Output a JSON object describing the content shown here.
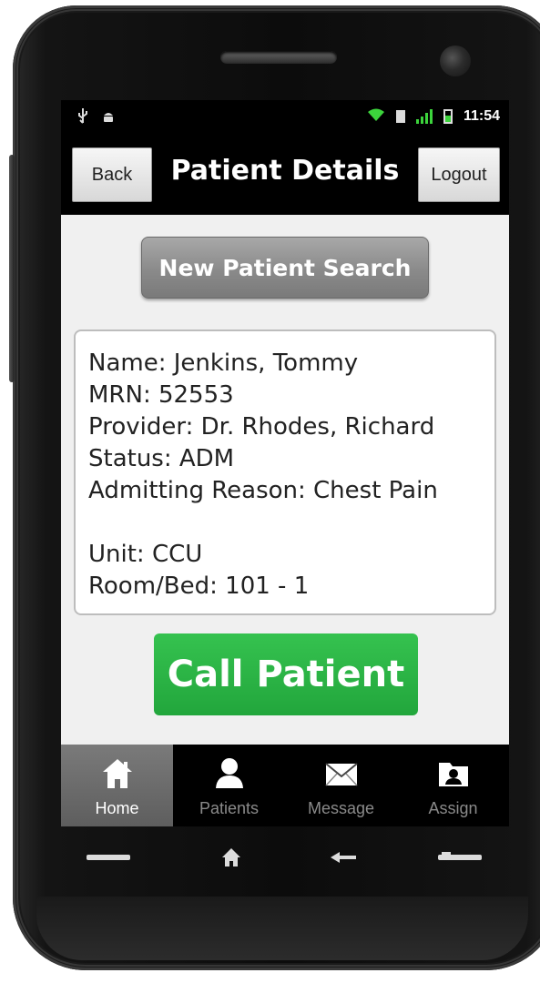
{
  "status_bar": {
    "time": "11:54",
    "icons": [
      "usb-icon",
      "android-icon",
      "wifi-icon",
      "sd-card-icon",
      "signal-icon",
      "battery-icon"
    ]
  },
  "title_bar": {
    "back_label": "Back",
    "title": "Patient Details",
    "logout_label": "Logout"
  },
  "actions": {
    "new_search_label": "New Patient Search",
    "call_label": "Call Patient"
  },
  "patient": {
    "name_line": "Name: Jenkins, Tommy",
    "mrn_line": "MRN: 52553",
    "provider_line": "Provider: Dr. Rhodes, Richard",
    "status_line": "Status: ADM",
    "reason_line": "Admitting Reason: Chest Pain",
    "unit_line": "Unit: CCU",
    "room_line": "Room/Bed: 101 - 1"
  },
  "tabs": [
    {
      "label": "Home",
      "icon": "home-icon",
      "active": true
    },
    {
      "label": "Patients",
      "icon": "person-icon",
      "active": false
    },
    {
      "label": "Message",
      "icon": "envelope-icon",
      "active": false
    },
    {
      "label": "Assign",
      "icon": "assign-icon",
      "active": false
    }
  ],
  "colors": {
    "call_green": "#2bb544",
    "search_gray": "#8e8e8e",
    "bar_black": "#000000",
    "status_green": "#3cd43c"
  },
  "hardware_buttons": [
    "menu-icon",
    "home-icon",
    "back-arrow-icon",
    "search-icon"
  ]
}
